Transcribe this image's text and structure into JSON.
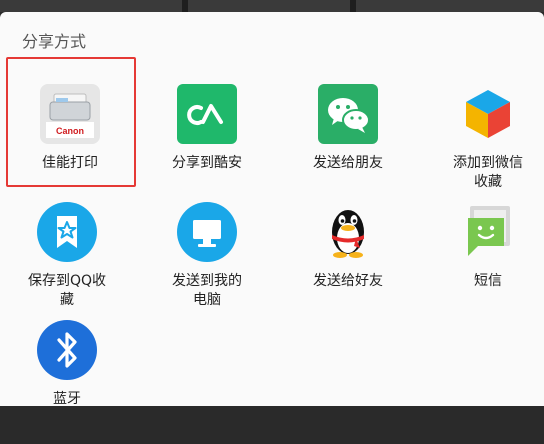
{
  "sheet": {
    "title": "分享方式"
  },
  "items": [
    {
      "label": "佳能打印",
      "icon": "canon-print-icon",
      "brand": "Canon"
    },
    {
      "label": "分享到酷安",
      "icon": "coolapk-icon"
    },
    {
      "label": "发送给朋友",
      "icon": "wechat-icon"
    },
    {
      "label": "添加到微信\n收藏",
      "icon": "wechat-favorites-icon"
    },
    {
      "label": "保存到QQ收\n藏",
      "icon": "qq-favorites-icon"
    },
    {
      "label": "发送到我的\n电脑",
      "icon": "my-computer-icon"
    },
    {
      "label": "发送给好友",
      "icon": "qq-penguin-icon"
    },
    {
      "label": "短信",
      "icon": "sms-icon"
    },
    {
      "label": "蓝牙",
      "icon": "bluetooth-icon"
    }
  ],
  "colors": {
    "selected_border": "#e53935",
    "coolapk": "#1fb86b",
    "wechat": "#2aae67",
    "qq_blue": "#1aa7e8",
    "sms": "#7ac74f",
    "bluetooth": "#1e6fd9"
  }
}
